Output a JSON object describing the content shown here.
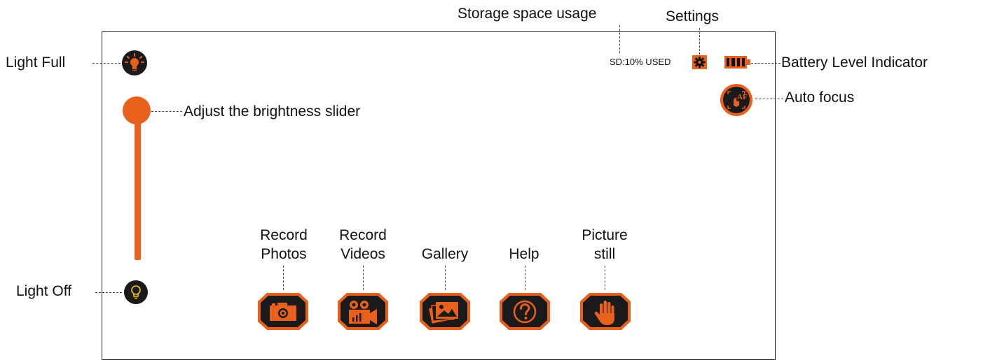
{
  "callouts": {
    "storage": "Storage space usage",
    "settings": "Settings",
    "light_full": "Light Full",
    "battery": "Battery Level Indicator",
    "auto_focus": "Auto focus",
    "brightness": "Adjust the brightness slider",
    "light_off": "Light Off"
  },
  "screen": {
    "sd_usage": "SD:10% USED",
    "af_label": "AF"
  },
  "buttons": [
    {
      "label_line1": "Record",
      "label_line2": "Photos",
      "icon": "camera-icon"
    },
    {
      "label_line1": "Record",
      "label_line2": "Videos",
      "icon": "video-camera-icon"
    },
    {
      "label_line1": "",
      "label_line2": "Gallery",
      "icon": "gallery-icon"
    },
    {
      "label_line1": "",
      "label_line2": "Help",
      "icon": "help-icon"
    },
    {
      "label_line1": "Picture",
      "label_line2": "still",
      "icon": "hand-icon"
    }
  ],
  "colors": {
    "accent": "#e8601c",
    "dark": "#1a1a1a",
    "icon_yellow": "#f5c518"
  }
}
